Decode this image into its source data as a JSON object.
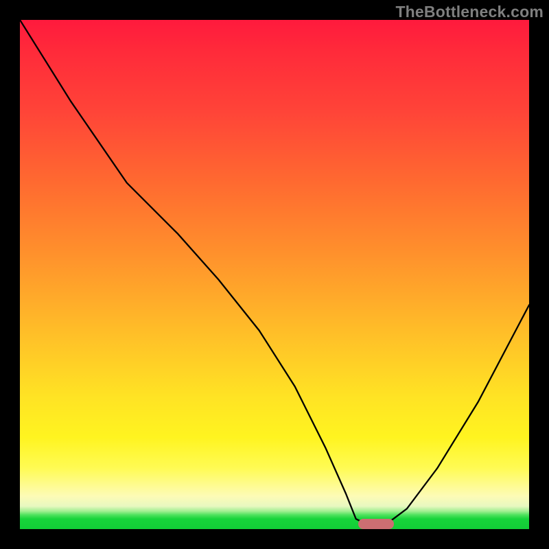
{
  "watermark": "TheBottleneck.com",
  "colors": {
    "frame": "#000000",
    "curve": "#000000",
    "marker": "#cc6e72",
    "gradient_top": "#ff1a3d",
    "gradient_bottom": "#12ce37",
    "watermark": "#7f7f7f"
  },
  "chart_data": {
    "type": "line",
    "title": "",
    "xlabel": "",
    "ylabel": "",
    "xlim": [
      0,
      100
    ],
    "ylim": [
      0,
      100
    ],
    "grid": false,
    "legend": false,
    "series": [
      {
        "name": "bottleneck-curve",
        "x": [
          0,
          10,
          21,
          31,
          39,
          47,
          54,
          60,
          64,
          66,
          68,
          72,
          76,
          82,
          90,
          100
        ],
        "values": [
          100,
          84,
          68,
          58,
          49,
          39,
          28,
          16,
          7,
          2,
          1,
          1,
          4,
          12,
          25,
          44
        ]
      }
    ],
    "annotations": [
      {
        "name": "optimal-marker",
        "x_center": 70,
        "y": 1,
        "width": 7,
        "height": 2
      }
    ]
  }
}
